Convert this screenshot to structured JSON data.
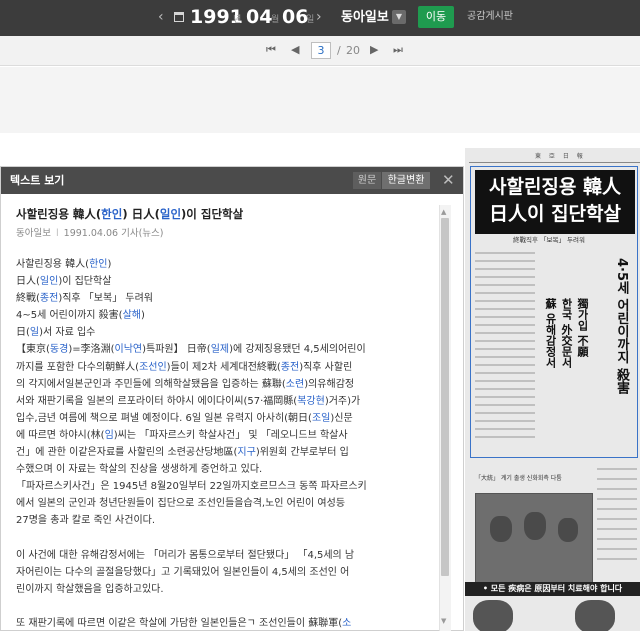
{
  "date": {
    "prev": "‹",
    "year": "1991",
    "year_unit": "년",
    "month": "04",
    "month_unit": "월",
    "day": "06",
    "day_unit": "일",
    "next": "›"
  },
  "paper": {
    "name": "동아일보",
    "dropdown": "▼"
  },
  "toolbar": {
    "move_label": "이동",
    "board_label": "공감게시판"
  },
  "pager": {
    "first": "⏮",
    "prev": "◀",
    "current": "3",
    "separator": "/",
    "total": "20",
    "next": "▶",
    "last": "⏭"
  },
  "panel": {
    "title": "텍스트 보기",
    "original_label": "원문",
    "convert_label": "한글변환",
    "close": "✕"
  },
  "article": {
    "headline_parts": [
      "사할린징용 韓人(",
      "한인",
      ") 日人(",
      "일인",
      ")이 집단학살"
    ],
    "byline": {
      "source": "동아일보",
      "sep": "l",
      "date": "1991.04.06",
      "type": "기사(뉴스)"
    },
    "lines": [
      [
        [
          "사할린징용 韓人(",
          ""
        ],
        [
          "한인",
          "hl"
        ],
        [
          ")",
          ""
        ]
      ],
      [
        [
          "日人(",
          ""
        ],
        [
          "일인",
          "hl"
        ],
        [
          ")이 집단학살",
          ""
        ]
      ],
      [
        [
          "終戰(",
          ""
        ],
        [
          "종전",
          "hl"
        ],
        [
          ")직후 「보복」 두려워",
          ""
        ]
      ],
      [
        [
          "4~5세 어린이까지 殺害(",
          ""
        ],
        [
          "살해",
          "hl"
        ],
        [
          ")",
          ""
        ]
      ],
      [
        [
          "日(",
          ""
        ],
        [
          "일",
          "hl"
        ],
        [
          ")서 자료 입수",
          ""
        ]
      ],
      [
        [
          "【東京(",
          ""
        ],
        [
          "동경",
          "hl"
        ],
        [
          ")=李洛淵(",
          ""
        ],
        [
          "이낙연",
          "hl"
        ],
        [
          ")특파원】 日帝(",
          ""
        ],
        [
          "일제",
          "hl"
        ],
        [
          ")에 강제징용됐던 4,5세의어린이",
          ""
        ]
      ],
      [
        [
          "까지를 포함한 다수의朝鮮人(",
          ""
        ],
        [
          "조선인",
          "hl"
        ],
        [
          ")들이 제2차 세계대전終戰(",
          ""
        ],
        [
          "종전",
          "hl"
        ],
        [
          ")직후 사할린",
          ""
        ]
      ],
      [
        [
          "의 각지에서일본군인과 주민들에 의해학살됐음을 입증하는 蘇聯(",
          ""
        ],
        [
          "소련",
          "hl"
        ],
        [
          ")의유해감정",
          ""
        ]
      ],
      [
        [
          "서와 재판기록을 일본의 르포라이터 하야시 에이다이씨(57·福岡縣(",
          ""
        ],
        [
          "복강현",
          "hl"
        ],
        [
          ")거주)가",
          ""
        ]
      ],
      [
        [
          "입수,금년 여름에 책으로 펴낼 예정이다. 6일 일본 유력지 아사히(朝日(",
          ""
        ],
        [
          "조일",
          "hl"
        ],
        [
          ")신문",
          ""
        ]
      ],
      [
        [
          "에 따르면 하야시(林(",
          ""
        ],
        [
          "임",
          "hl"
        ],
        [
          ")씨는 「파자르스키 학살사건」 및 「레오니드브 학살사",
          ""
        ]
      ],
      [
        [
          "건」에 관한 이같은자료를 사할린의 소련공산당地區(",
          ""
        ],
        [
          "지구",
          "hl"
        ],
        [
          ")위원회 간부로부터 입",
          ""
        ]
      ],
      [
        [
          "수했으며 이 자료는 학살의 진상을 생생하게 증언하고 있다.",
          ""
        ]
      ],
      [
        [
          "「파자르스키사건」은 1945년 8월20일부터 22일까지호르므스크 동쪽 파자르스키",
          ""
        ]
      ],
      [
        [
          "에서 일본의 군인과 청년단원들이 집단으로 조선인들을습격,노인 어린이 여성등",
          ""
        ]
      ],
      [
        [
          "27명을 총과 칼로 죽인 사건이다.",
          ""
        ]
      ],
      [],
      [
        [
          " 이 사건에 대한 유해감정서에는 「머리가 몸통으로부터 절단됐다」 「4,5세의 남",
          ""
        ]
      ],
      [
        [
          "자어린이는 다수의 골절을당했다」고 기록돼있어 일본인들이 4,5세의 조선인 어",
          ""
        ]
      ],
      [
        [
          "린이까지 학살했음을 입증하고있다.",
          ""
        ]
      ],
      [],
      [
        [
          " 또 재판기록에 따르면 이같은 학살에 가담한 일본인들은ㄱ 조선인들이 蘇聯軍(",
          ""
        ],
        [
          "소",
          "hl"
        ]
      ]
    ]
  },
  "newspaper": {
    "masthead": "東 亞 日 報",
    "title_line1": "사할린징용 韓人",
    "title_line2": "日人이 집단학살",
    "subtitle": "終戰직후 「보복」 두려워",
    "vertical_1": "4·5세 어린이까지 殺害",
    "vertical_2": "蘇 유해감정서",
    "vertical_3": "한국 外交문서",
    "vertical_4": "獨가입 不願",
    "photo_caption": "「大統」 계기 출생 신화회측 다툼",
    "banner": "• 모든 疾病은 原因부터 치료해야 합니다"
  }
}
